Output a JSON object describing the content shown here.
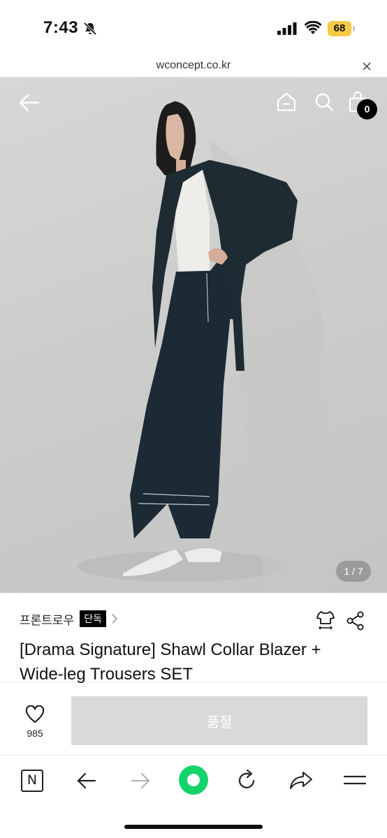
{
  "status_bar": {
    "time": "7:43",
    "battery": "68"
  },
  "url_bar": {
    "domain": "wconcept.co.kr"
  },
  "hero": {
    "cart_count": "0",
    "image_counter": "1 / 7"
  },
  "product": {
    "brand": "프론트로우",
    "exclusive_badge": "단독",
    "title": "[Drama Signature] Shawl Collar Blazer + Wide-leg Trousers SET"
  },
  "actions": {
    "like_count": "985",
    "soldout_label": "품절"
  },
  "toolbar": {
    "naver_label": "N"
  },
  "colors": {
    "soldout_bg": "#d9d9d9",
    "green_button": "#14d36b",
    "battery": "#f6c945"
  }
}
